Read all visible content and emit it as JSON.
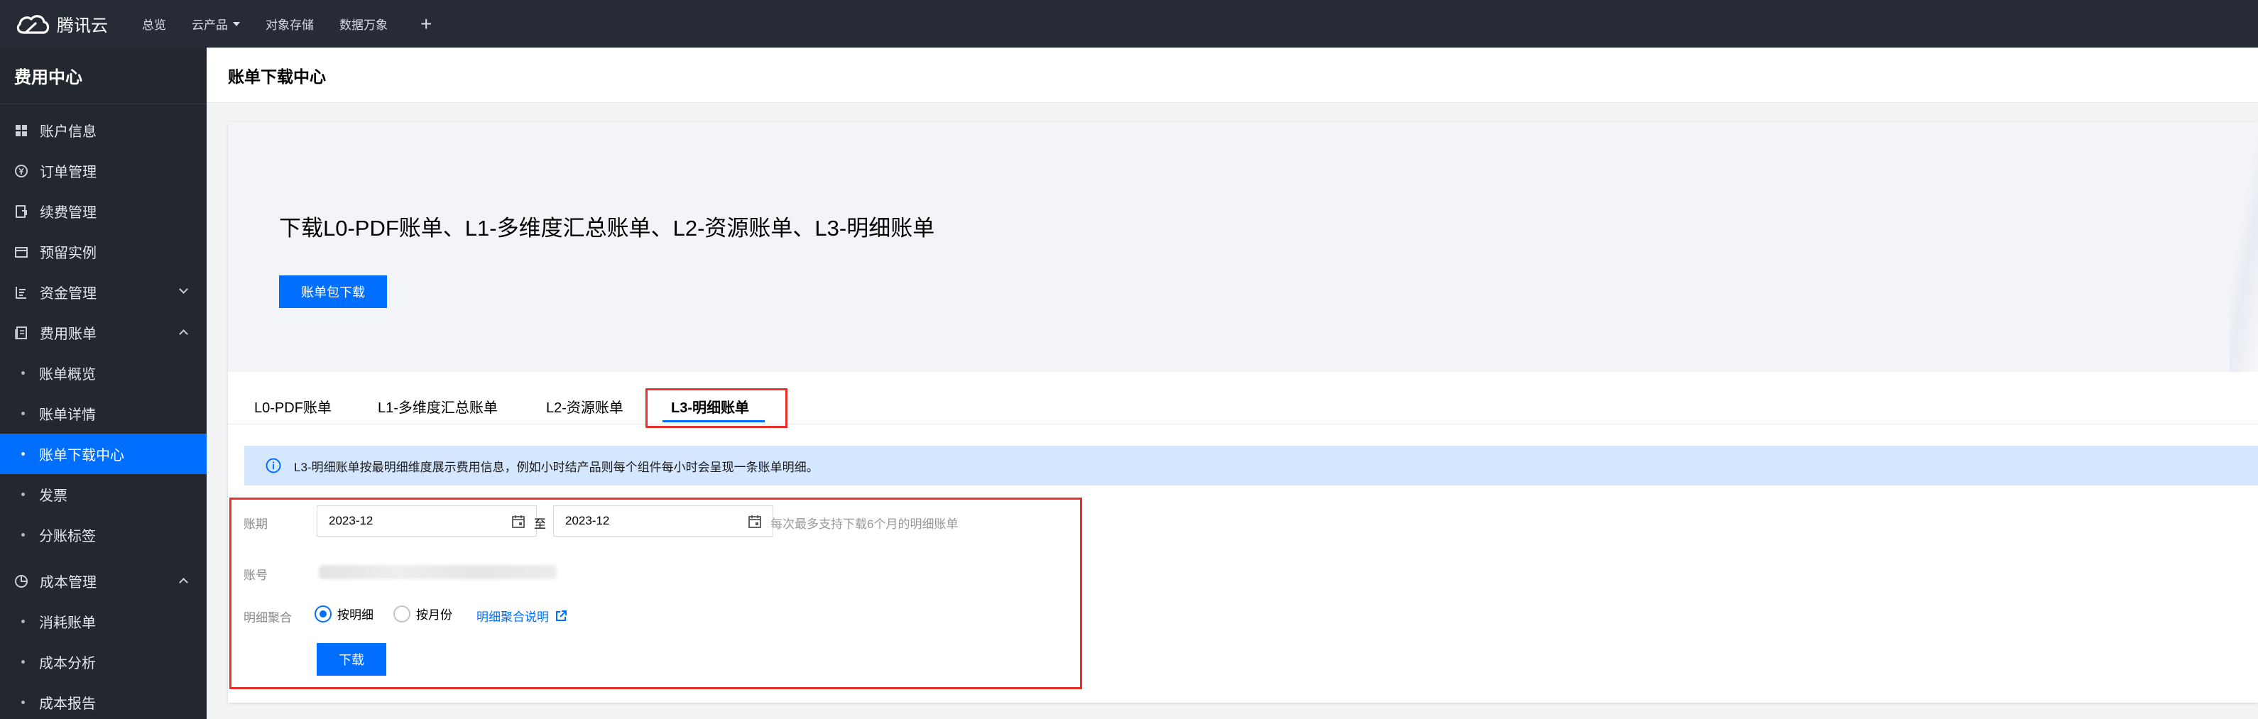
{
  "topbar": {
    "logo_text": "腾讯云",
    "nav": [
      "总览",
      "云产品",
      "对象存储",
      "数据万象"
    ],
    "add_icon": "+"
  },
  "sidebar": {
    "title": "费用中心",
    "items": {
      "account_info": "账户信息",
      "order_mgmt": "订单管理",
      "renewal_mgmt": "续费管理",
      "reserved_instance": "预留实例",
      "fund_mgmt": "资金管理",
      "billing": "费用账单",
      "bill_overview": "账单概览",
      "bill_details": "账单详情",
      "bill_download": "账单下载中心",
      "invoice": "发票",
      "split_tags": "分账标签",
      "cost_mgmt": "成本管理",
      "consumption_bill": "消耗账单",
      "cost_analysis": "成本分析",
      "cost_report": "成本报告"
    }
  },
  "page": {
    "title": "账单下载中心"
  },
  "banner": {
    "title": "下载L0-PDF账单、L1-多维度汇总账单、L2-资源账单、L3-明细账单",
    "button": "账单包下载"
  },
  "tabs": [
    "L0-PDF账单",
    "L1-多维度汇总账单",
    "L2-资源账单",
    "L3-明细账单"
  ],
  "active_tab": "L3-明细账单",
  "notice": "L3-明细账单按最明细维度展示费用信息，例如小时结产品则每个组件每小时会呈现一条账单明细。",
  "form": {
    "period_label": "账期",
    "start_date": "2023-12",
    "to": "至",
    "end_date": "2023-12",
    "period_hint": "每次最多支持下载6个月的明细账单",
    "account_label": "账号",
    "aggregation_label": "明细聚合",
    "radio_detail": "按明细",
    "radio_month": "按月份",
    "aggregation_help": "明细聚合说明",
    "download_button": "下载"
  },
  "colors": {
    "brand": "#006eff",
    "topbar": "#262b36",
    "sidebar": "#23272f",
    "highlight_box": "#e5312b",
    "notice_bg": "#d5e7ff"
  }
}
